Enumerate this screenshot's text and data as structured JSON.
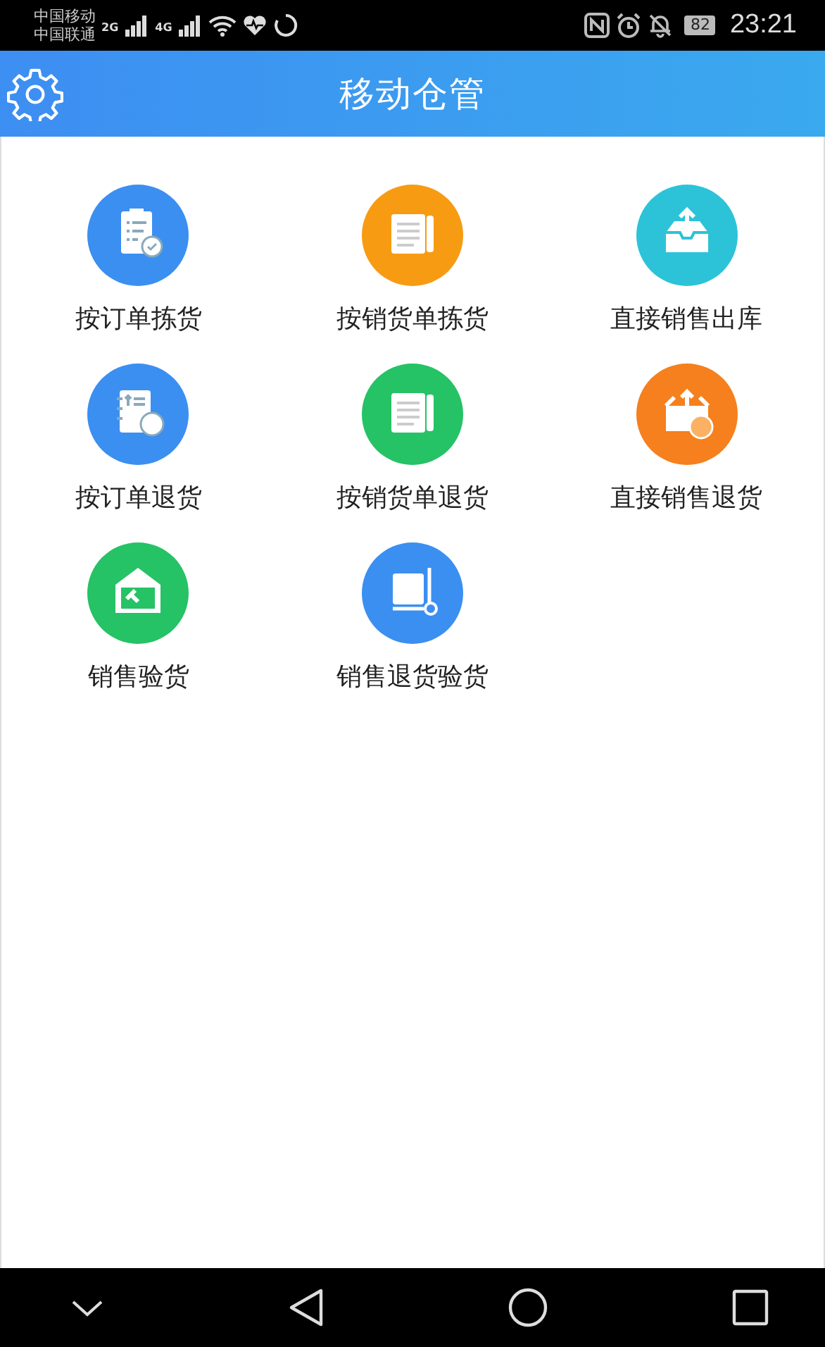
{
  "status_bar": {
    "carrier_1": "中国移动",
    "carrier_2": "中国联通",
    "network_1": "2G",
    "network_2": "4G",
    "battery": "82",
    "time": "23:21"
  },
  "header": {
    "title": "移动仓管"
  },
  "menu": [
    {
      "label": "按订单拣货",
      "kind": "clipboard",
      "color": "#3b8ff0"
    },
    {
      "label": "按销货单拣货",
      "kind": "document",
      "color": "#f79b12"
    },
    {
      "label": "直接销售出库",
      "kind": "inbox",
      "color": "#2cc3d8"
    },
    {
      "label": "按订单退货",
      "kind": "notebook",
      "color": "#3b8ff0"
    },
    {
      "label": "按销货单退货",
      "kind": "document",
      "color": "#26c266"
    },
    {
      "label": "直接销售退货",
      "kind": "box",
      "color": "#f5801d"
    },
    {
      "label": "销售验货",
      "kind": "warehouse",
      "color": "#26c266"
    },
    {
      "label": "销售退货验货",
      "kind": "trolley",
      "color": "#3b8ff0"
    }
  ]
}
